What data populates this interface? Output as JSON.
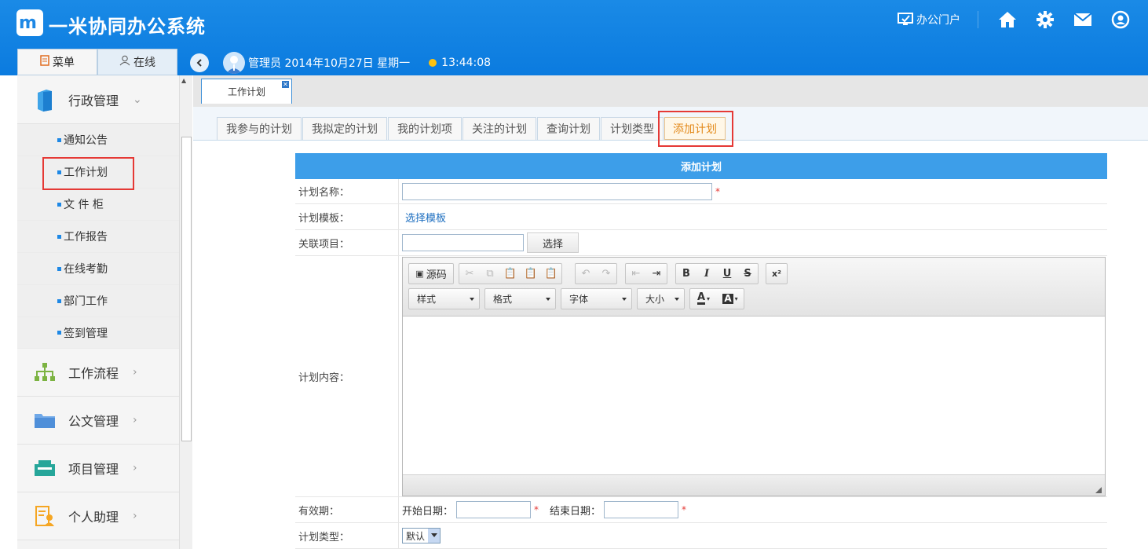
{
  "app": {
    "title": "一米协同办公系统",
    "logo_text": "m"
  },
  "header": {
    "portal_label": "办公门户",
    "icons": [
      "home-icon",
      "gear-icon",
      "mail-icon",
      "user-circle-icon"
    ]
  },
  "menu_tabs": [
    {
      "label": "菜单",
      "active": true
    },
    {
      "label": "在线",
      "active": false
    }
  ],
  "user_bar": {
    "user_date": "管理员 2014年10月27日 星期一",
    "time": "13:44:08"
  },
  "sidebar": {
    "groups": [
      {
        "label": "行政管理",
        "expanded": true,
        "icon": "book-icon"
      },
      {
        "label": "工作流程",
        "expanded": false,
        "icon": "org-chart-icon"
      },
      {
        "label": "公文管理",
        "expanded": false,
        "icon": "folder-icon"
      },
      {
        "label": "项目管理",
        "expanded": false,
        "icon": "project-icon"
      },
      {
        "label": "个人助理",
        "expanded": false,
        "icon": "assistant-icon"
      }
    ],
    "items": [
      "通知公告",
      "工作计划",
      "文 件 柜",
      "工作报告",
      "在线考勤",
      "部门工作",
      "签到管理"
    ],
    "highlighted_item": "工作计划"
  },
  "document_tab": {
    "label": "工作计划"
  },
  "sub_tabs": [
    {
      "label": "我参与的计划",
      "active": false
    },
    {
      "label": "我拟定的计划",
      "active": false
    },
    {
      "label": "我的计划项",
      "active": false
    },
    {
      "label": "关注的计划",
      "active": false
    },
    {
      "label": "查询计划",
      "active": false
    },
    {
      "label": "计划类型",
      "active": false
    },
    {
      "label": "添加计划",
      "active": true
    }
  ],
  "form": {
    "title": "添加计划",
    "plan_name_label": "计划名称：",
    "plan_name_value": "",
    "template_label": "计划模板：",
    "template_link": "选择模板",
    "project_label": "关联项目：",
    "project_value": "",
    "select_button": "选择",
    "content_label": "计划内容：",
    "validity_label": "有效期：",
    "start_label": "开始日期：",
    "end_label": "结束日期：",
    "start_value": "",
    "end_value": "",
    "type_label": "计划类型：",
    "type_value": "默认",
    "required_mark": "*"
  },
  "editor": {
    "source_label": "源码",
    "style_select": "样式",
    "format_select": "格式",
    "font_select": "字体",
    "size_select": "大小",
    "bold": "B",
    "italic": "I",
    "underline": "U",
    "strike": "S",
    "superscript": "x²",
    "text_color": "A",
    "bg_color": "A"
  },
  "colors": {
    "header_blue": "#0b7bdf",
    "form_header": "#3d9ee9",
    "highlight_red": "#e53935",
    "active_tab_text": "#e38a1b"
  }
}
